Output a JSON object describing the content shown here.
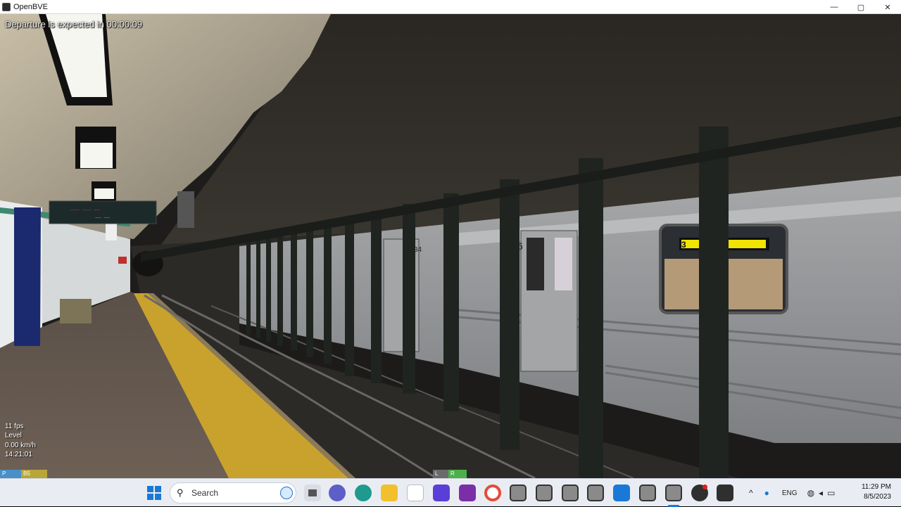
{
  "window": {
    "title": "OpenBVE",
    "minimize_glyph": "—",
    "maximize_glyph": "▢",
    "close_glyph": "✕"
  },
  "hud": {
    "message": "Departure is expected in 00:00:09",
    "fps": "11 fps",
    "track_status": "Level",
    "speed": "0.00 km/h",
    "game_time": "14:21:01",
    "left_indicators": [
      "P",
      "B5"
    ],
    "right_indicators": [
      "L",
      "R"
    ]
  },
  "scene": {
    "station_sign_line1": "——— ——— ——",
    "station_sign_line2": "—— ——",
    "car_numbers": [
      "34",
      "6"
    ],
    "destination_sign": "3"
  },
  "taskbar": {
    "search_placeholder": "Search",
    "pinned_icons": [
      "start-icon",
      "search-icon",
      "task-view-icon",
      "chat-icon",
      "edge-icon",
      "file-explorer-icon",
      "store-icon",
      "creative-app-icon",
      "onenote-icon",
      "chrome-icon",
      "openbve-icon",
      "openbve-icon-2",
      "openbve-icon-3",
      "openbve-icon-4",
      "route-viewer-icon",
      "openbve-icon-5",
      "openbve-icon-6",
      "obs-icon",
      "terminal-icon"
    ],
    "tray": {
      "language": "ENG"
    },
    "clock_time": "11:29 PM",
    "clock_date": "8/5/2023"
  },
  "colors": {
    "safety_strip": "#c9a22e",
    "pillar_blue": "#1b2a6e",
    "train_body": "#8f9194",
    "taskbar_bg": "#e9edf3"
  }
}
